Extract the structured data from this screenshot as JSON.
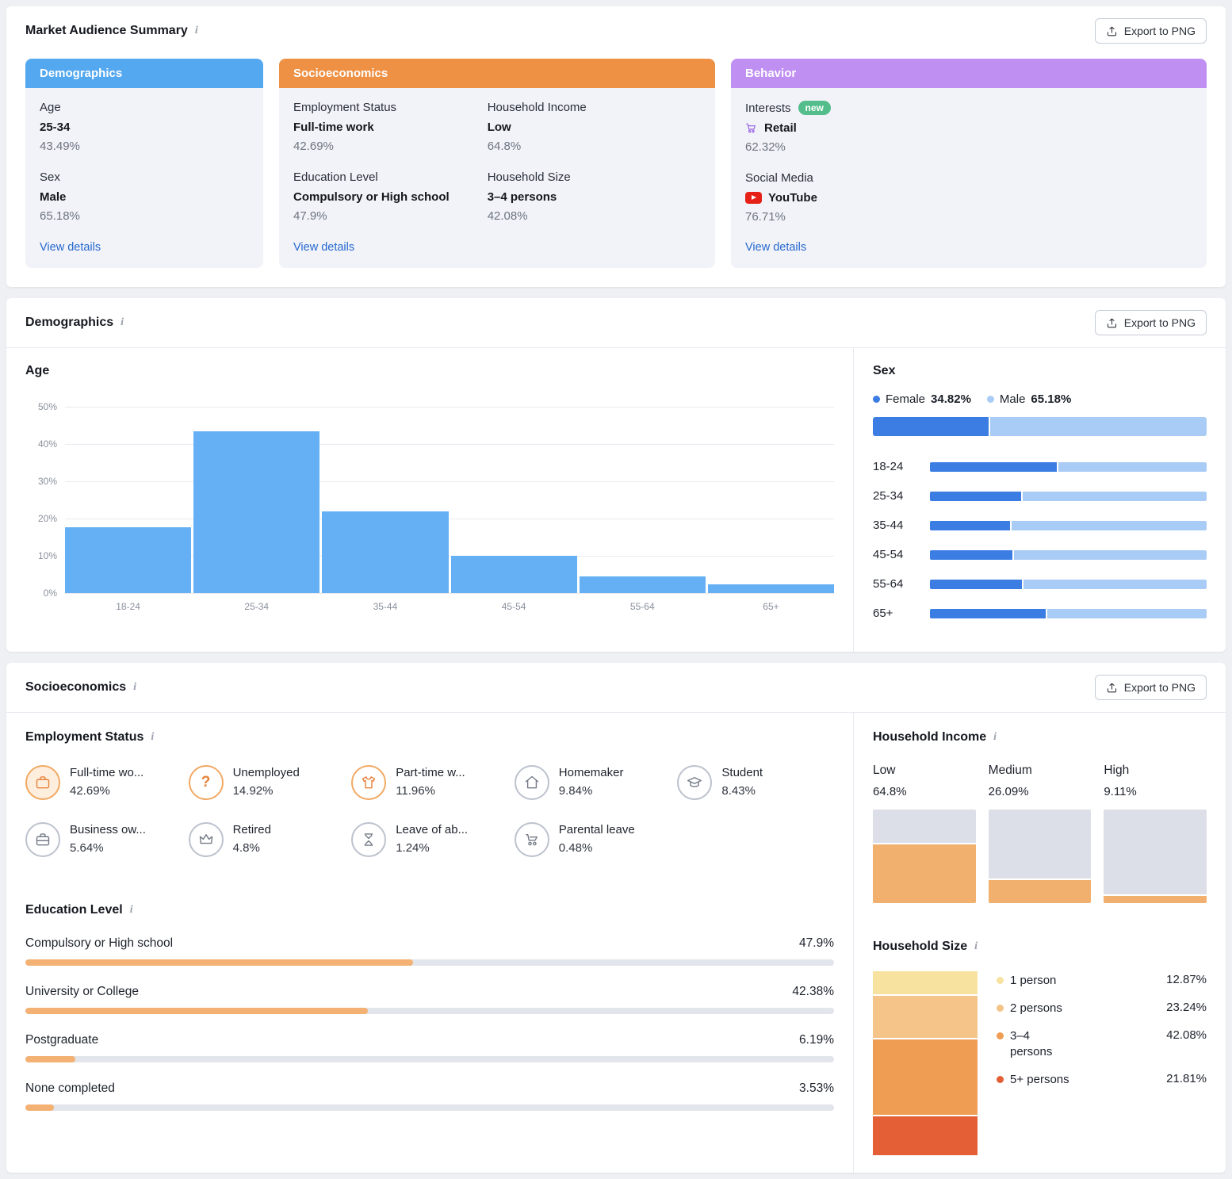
{
  "page": {
    "export_label": "Export to PNG",
    "view_details_label": "View details"
  },
  "summary": {
    "title": "Market Audience Summary",
    "cards": [
      {
        "id": "demographics",
        "title": "Demographics",
        "header_color": "#54a8f0",
        "columns": [
          {
            "stats": [
              {
                "label": "Age",
                "value": "25-34",
                "pct": "43.49%"
              },
              {
                "label": "Sex",
                "value": "Male",
                "pct": "65.18%"
              }
            ]
          }
        ]
      },
      {
        "id": "socioeconomics",
        "title": "Socioeconomics",
        "header_color": "#ee9145",
        "columns": [
          {
            "stats": [
              {
                "label": "Employment Status",
                "value": "Full-time work",
                "pct": "42.69%"
              },
              {
                "label": "Education Level",
                "value": "Compulsory or High school",
                "pct": "47.9%"
              }
            ]
          },
          {
            "stats": [
              {
                "label": "Household Income",
                "value": "Low",
                "pct": "64.8%"
              },
              {
                "label": "Household Size",
                "value": "3–4 persons",
                "pct": "42.08%"
              }
            ]
          }
        ]
      },
      {
        "id": "behavior",
        "title": "Behavior",
        "header_color": "#c08ff2",
        "columns": [
          {
            "stats": [
              {
                "label": "Interests",
                "badge": "new",
                "icon": "retail-cart",
                "value": "Retail",
                "pct": "62.32%"
              },
              {
                "label": "Social Media",
                "icon": "youtube",
                "value": "YouTube",
                "pct": "76.71%"
              }
            ]
          }
        ]
      }
    ]
  },
  "demographics_section": {
    "title": "Demographics",
    "age_title": "Age",
    "sex_title": "Sex"
  },
  "socioeconomics_section": {
    "title": "Socioeconomics",
    "employment": {
      "title": "Employment Status",
      "items": [
        {
          "name": "Full-time wo...",
          "pct": "42.69%",
          "icon": "briefcase",
          "style": "orange-filled"
        },
        {
          "name": "Unemployed",
          "pct": "14.92%",
          "icon": "question",
          "style": "orange"
        },
        {
          "name": "Part-time w...",
          "pct": "11.96%",
          "icon": "tshirt",
          "style": "orange"
        },
        {
          "name": "Homemaker",
          "pct": "9.84%",
          "icon": "home",
          "style": "gray"
        },
        {
          "name": "Student",
          "pct": "8.43%",
          "icon": "gradcap",
          "style": "gray"
        },
        {
          "name": "Business ow...",
          "pct": "5.64%",
          "icon": "suitcase",
          "style": "gray"
        },
        {
          "name": "Retired",
          "pct": "4.8%",
          "icon": "crown",
          "style": "gray"
        },
        {
          "name": "Leave of ab...",
          "pct": "1.24%",
          "icon": "hourglass",
          "style": "gray"
        },
        {
          "name": "Parental leave",
          "pct": "0.48%",
          "icon": "stroller",
          "style": "gray"
        }
      ]
    },
    "education": {
      "title": "Education Level"
    },
    "income": {
      "title": "Household Income"
    },
    "household_size": {
      "title": "Household Size"
    }
  },
  "chart_data": [
    {
      "id": "age-distribution",
      "type": "bar",
      "title": "Age",
      "categories": [
        "18-24",
        "25-34",
        "35-44",
        "45-54",
        "55-64",
        "65+"
      ],
      "values": [
        17.6,
        43.49,
        22.0,
        10.1,
        4.5,
        2.3
      ],
      "estimated_except": "25-34 = 43.49",
      "ylim": [
        0,
        50
      ],
      "yticks": [
        0,
        10,
        20,
        30,
        40,
        50
      ],
      "color": "#65b0f4",
      "grid": true
    },
    {
      "id": "sex-by-age",
      "type": "bar",
      "subtype": "stacked-horizontal",
      "title": "Sex",
      "categories": [
        "18-24",
        "25-34",
        "35-44",
        "45-54",
        "55-64",
        "65+"
      ],
      "series": [
        {
          "name": "Female",
          "color": "#3b7de2",
          "total": 34.82,
          "values": [
            46,
            33,
            29,
            30,
            33.5,
            42
          ]
        },
        {
          "name": "Male",
          "color": "#a9ccf6",
          "total": 65.18,
          "values": [
            54,
            67,
            71,
            70,
            66.5,
            58
          ]
        }
      ],
      "by_age_values_estimated": true,
      "legend_position": "top"
    },
    {
      "id": "education-level",
      "type": "bar",
      "subtype": "horizontal",
      "categories": [
        "Compulsory or High school",
        "University or College",
        "Postgraduate",
        "None completed"
      ],
      "values": [
        47.9,
        42.38,
        6.19,
        3.53
      ],
      "color": "#f3b273",
      "track_color": "#e3e5ec",
      "xlim": [
        0,
        100
      ]
    },
    {
      "id": "household-income",
      "type": "bar",
      "categories": [
        "Low",
        "Medium",
        "High"
      ],
      "values": [
        64.8,
        26.09,
        9.11
      ],
      "color": "#f2b06e",
      "track_color": "#dcdfe8",
      "ylim": [
        0,
        100
      ]
    },
    {
      "id": "household-size",
      "type": "bar",
      "subtype": "stacked-column",
      "categories": [
        "1 person",
        "2 persons",
        "3–4 persons",
        "5+ persons"
      ],
      "values": [
        12.87,
        23.24,
        42.08,
        21.81
      ],
      "colors": [
        "#f8e2a0",
        "#f4c489",
        "#ef9d52",
        "#e45f35"
      ],
      "legend_position": "right"
    }
  ]
}
